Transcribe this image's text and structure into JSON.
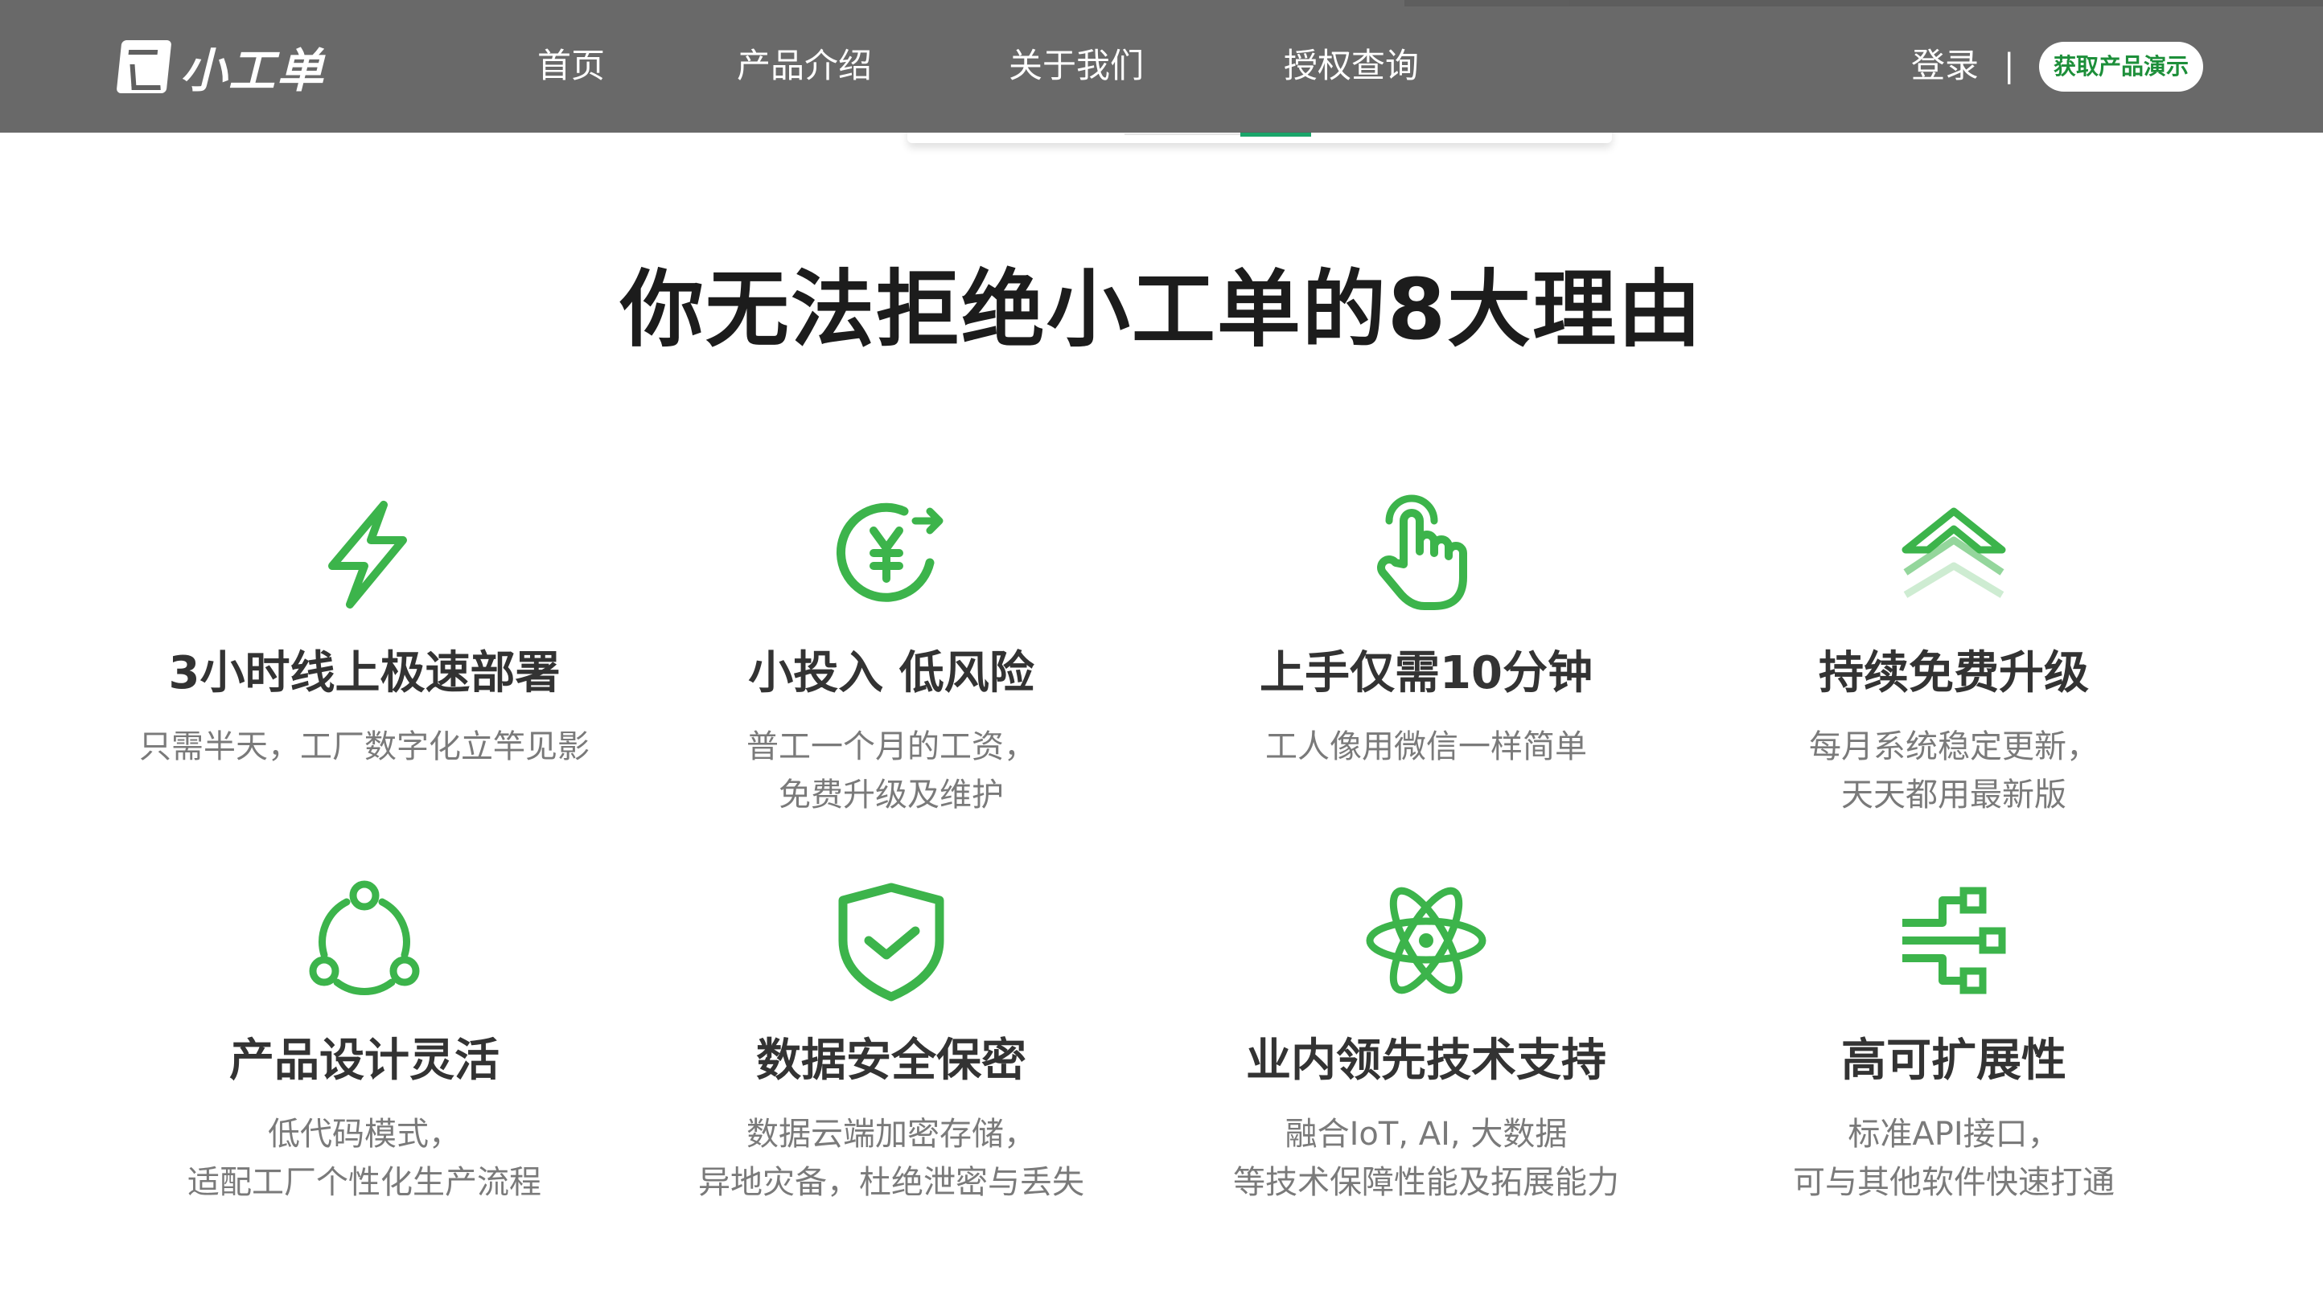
{
  "brand": {
    "name": "小工单",
    "accent_color": "#1d8f3a",
    "icon_color": "#3cb44b"
  },
  "nav": {
    "items": [
      "首页",
      "产品介绍",
      "关于我们",
      "授权查询"
    ],
    "login": "登录",
    "separator": "|",
    "demo_button": "获取产品演示"
  },
  "section": {
    "title": "你无法拒绝小工单的8大理由"
  },
  "features": [
    {
      "icon": "lightning-icon",
      "title": "3小时线上极速部署",
      "desc": [
        "只需半天，工厂数字化立竿见影"
      ]
    },
    {
      "icon": "yuan-refresh-icon",
      "title": "小投入 低风险",
      "desc": [
        "普工一个月的工资，",
        "免费升级及维护"
      ]
    },
    {
      "icon": "tap-hand-icon",
      "title": "上手仅需10分钟",
      "desc": [
        "工人像用微信一样简单"
      ]
    },
    {
      "icon": "layers-up-icon",
      "title": "持续免费升级",
      "desc": [
        "每月系统稳定更新，",
        "天天都用最新版"
      ]
    },
    {
      "icon": "share-circle-icon",
      "title": "产品设计灵活",
      "desc": [
        "低代码模式，",
        "适配工厂个性化生产流程"
      ]
    },
    {
      "icon": "shield-check-icon",
      "title": "数据安全保密",
      "desc": [
        "数据云端加密存储，",
        "异地灾备，杜绝泄密与丢失"
      ]
    },
    {
      "icon": "atom-icon",
      "title": "业内领先技术支持",
      "desc": [
        "融合IoT, AI, 大数据",
        "等技术保障性能及拓展能力"
      ]
    },
    {
      "icon": "network-branch-icon",
      "title": "高可扩展性",
      "desc": [
        "标准API接口，",
        "可与其他软件快速打通"
      ]
    }
  ]
}
